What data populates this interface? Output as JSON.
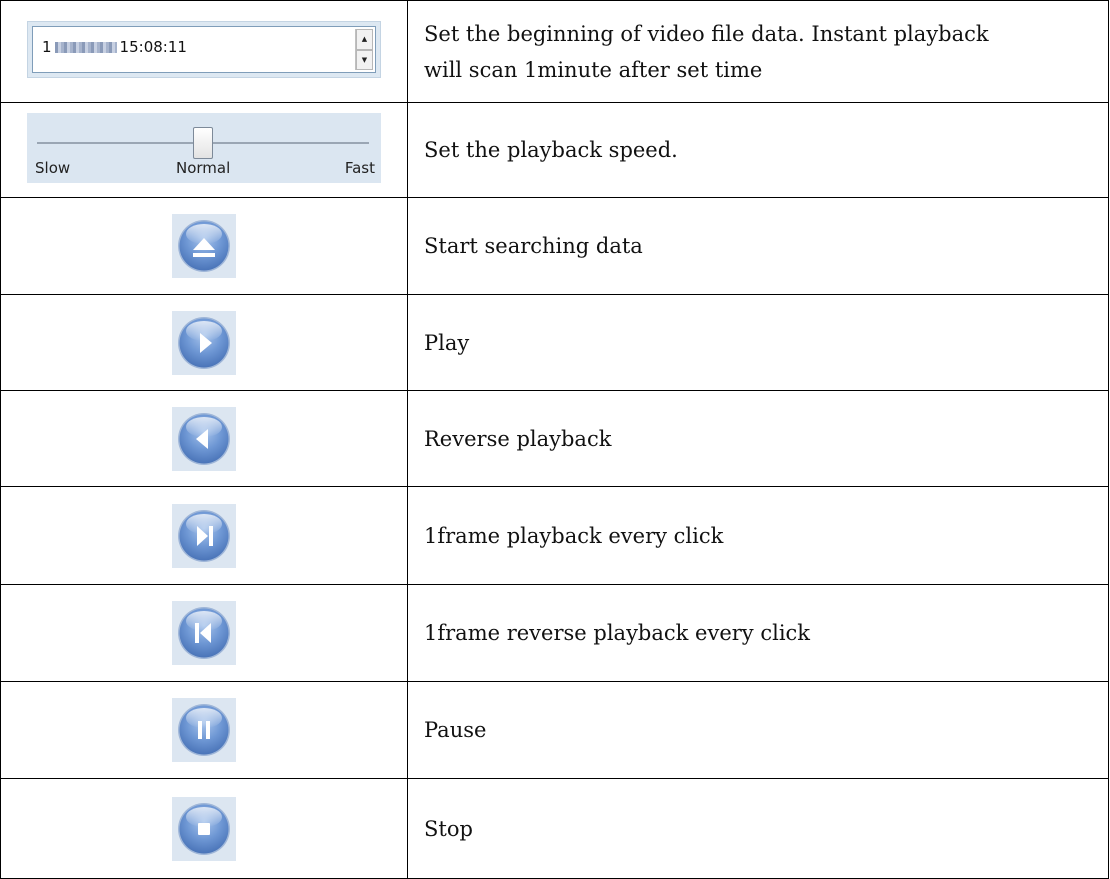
{
  "datetime": {
    "prefix": "1",
    "time": "15:08:11"
  },
  "slider": {
    "slow": "Slow",
    "normal": "Normal",
    "fast": "Fast",
    "value": 0.5
  },
  "rows": [
    {
      "desc1": "Set the beginning of video file data. Instant playback",
      "desc2": "will scan 1minute after set time"
    },
    {
      "desc": "Set the playback speed."
    },
    {
      "desc": "Start searching data",
      "icon": "eject-icon"
    },
    {
      "desc": "Play",
      "icon": "play-icon"
    },
    {
      "desc": "Reverse playback",
      "icon": "reverse-play-icon"
    },
    {
      "desc": "1frame playback every click",
      "icon": "frame-forward-icon"
    },
    {
      "desc": "1frame reverse playback every click",
      "icon": "frame-backward-icon"
    },
    {
      "desc": "Pause",
      "icon": "pause-icon"
    },
    {
      "desc": "Stop",
      "icon": "stop-icon"
    }
  ]
}
